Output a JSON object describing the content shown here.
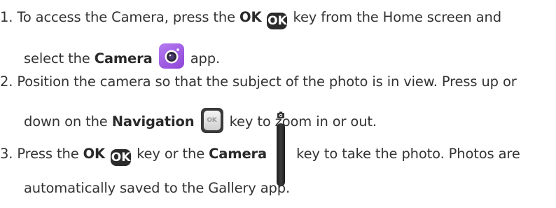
{
  "steps": [
    {
      "number": "1.",
      "line1_a": "To access the Camera, press the ",
      "line1_b": "OK",
      "line1_c": " key from the Home screen and",
      "line2_a": "select the ",
      "line2_b": "Camera",
      "line2_c": " app."
    },
    {
      "number": "2.",
      "line1": "Position the camera so that the subject of the photo is in view. Press up or",
      "line2_a": "down on the ",
      "line2_b": "Navigation",
      "line2_c": " key to zoom in or out."
    },
    {
      "number": "3.",
      "line1_a": "Press the ",
      "line1_b": "OK",
      "line1_c": " key or the ",
      "line1_d": "Camera",
      "line1_e": " key to take the photo. Photos are",
      "line2": "automatically saved to the Gallery app."
    }
  ],
  "keys": {
    "ok_key_label": "OK",
    "nav_key_label": "OK"
  },
  "icons": {
    "ok_key": "ok-key-icon",
    "camera_app": "camera-app-icon",
    "navigation_key": "navigation-key-icon",
    "camera_side_key": "camera-side-key-icon"
  },
  "colors": {
    "text": "#333333",
    "key_dark": "#2b2b2b",
    "camera_app_purple": "#9b59e0"
  }
}
